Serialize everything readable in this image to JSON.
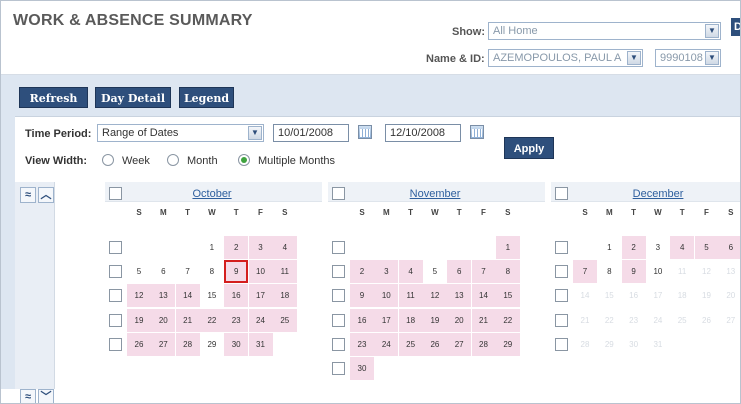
{
  "header": {
    "title": "WORK & ABSENCE SUMMARY",
    "show_label": "Show:",
    "show_value": "All Home",
    "name_label": "Name & ID:",
    "name_value": "AZEMOPOULOS, PAUL A",
    "id_value": "9990108",
    "edge_button": "D"
  },
  "toolbar": {
    "refresh": "Refresh",
    "day_detail": "Day Detail",
    "legend": "Legend"
  },
  "filters": {
    "time_period_label": "Time Period:",
    "time_period_value": "Range of Dates",
    "start_date": "10/01/2008",
    "end_date": "12/10/2008",
    "apply": "Apply",
    "view_width_label": "View Width:",
    "view_options": [
      "Week",
      "Month",
      "Multiple Months"
    ],
    "view_selected": "Multiple Months"
  },
  "nav": {
    "up_fast": "≈",
    "up": "︿",
    "down_fast": "≈",
    "down": "﹀"
  },
  "calendar": {
    "dow": [
      "S",
      "M",
      "T",
      "W",
      "T",
      "F",
      "S"
    ],
    "today": "October 9",
    "months": [
      {
        "name": "October",
        "weeks": [
          [
            null,
            null,
            null,
            1,
            2,
            3,
            4
          ],
          [
            5,
            6,
            7,
            8,
            9,
            10,
            11
          ],
          [
            12,
            13,
            14,
            15,
            16,
            17,
            18
          ],
          [
            19,
            20,
            21,
            22,
            23,
            24,
            25
          ],
          [
            26,
            27,
            28,
            29,
            30,
            31,
            null
          ]
        ]
      },
      {
        "name": "November",
        "weeks": [
          [
            null,
            null,
            null,
            null,
            null,
            null,
            1
          ],
          [
            2,
            3,
            4,
            5,
            6,
            7,
            8
          ],
          [
            9,
            10,
            11,
            12,
            13,
            14,
            15
          ],
          [
            16,
            17,
            18,
            19,
            20,
            21,
            22
          ],
          [
            23,
            24,
            25,
            26,
            27,
            28,
            29
          ],
          [
            30,
            null,
            null,
            null,
            null,
            null,
            null
          ]
        ]
      },
      {
        "name": "December",
        "weeks": [
          [
            null,
            1,
            2,
            3,
            4,
            5,
            6
          ],
          [
            7,
            8,
            9,
            10,
            11,
            12,
            13
          ],
          [
            14,
            15,
            16,
            17,
            18,
            19,
            20
          ],
          [
            21,
            22,
            23,
            24,
            25,
            26,
            27
          ],
          [
            28,
            29,
            30,
            31,
            null,
            null,
            null
          ]
        ]
      }
    ],
    "pink_days": {
      "October": [
        2,
        3,
        4,
        9,
        10,
        11,
        12,
        13,
        14,
        16,
        17,
        18,
        19,
        20,
        21,
        22,
        23,
        24,
        25,
        26,
        27,
        28,
        30,
        31
      ],
      "November": [
        1,
        2,
        3,
        4,
        6,
        7,
        8,
        9,
        10,
        11,
        12,
        13,
        14,
        15,
        16,
        17,
        18,
        19,
        20,
        21,
        22,
        23,
        24,
        25,
        26,
        27,
        28,
        29,
        30
      ],
      "December": [
        2,
        4,
        5,
        6,
        7,
        9
      ]
    },
    "future_after": {
      "month": "December",
      "day": 10
    }
  },
  "colors": {
    "brand": "#2e4f7c",
    "highlight": "#f5dbe8",
    "today_border": "#d41e1e",
    "band": "#dde6f1"
  }
}
